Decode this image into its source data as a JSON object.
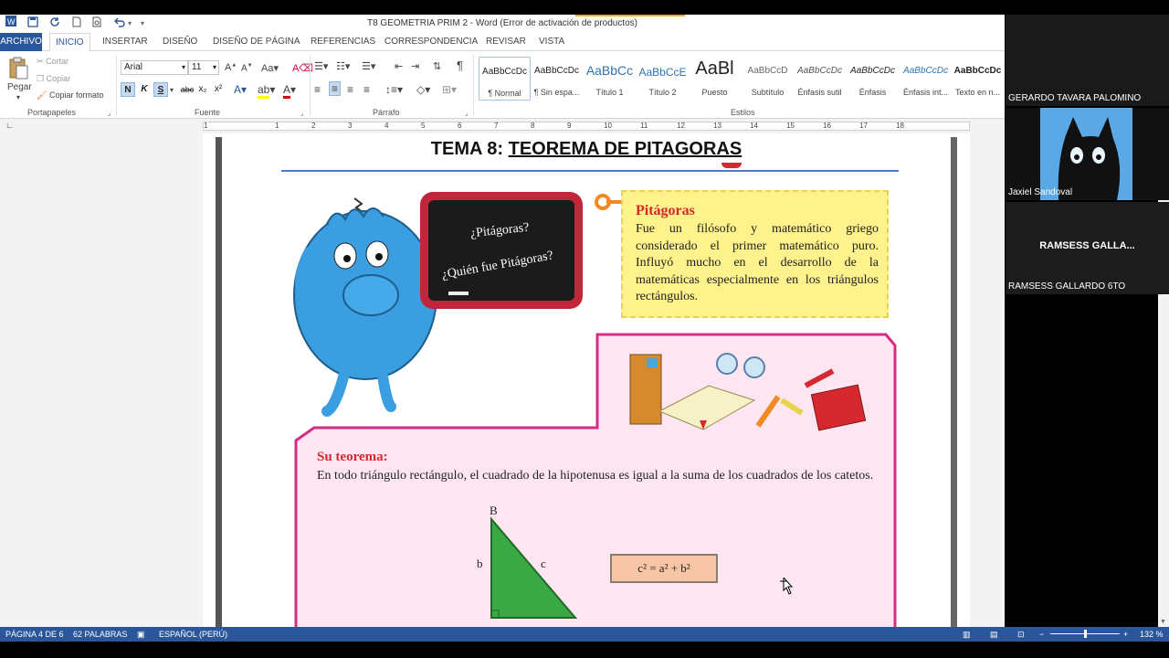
{
  "window": {
    "title": "T8 GEOMETRIA PRIM 2 - Word (Error de activación de productos)"
  },
  "tabs": [
    "ARCHIVO",
    "INICIO",
    "INSERTAR",
    "DISEÑO",
    "DISEÑO DE PÁGINA",
    "REFERENCIAS",
    "CORRESPONDENCIA",
    "REVISAR",
    "VISTA"
  ],
  "clipboard": {
    "paste": "Pegar",
    "cut": "Cortar",
    "copy": "Copiar",
    "format_painter": "Copiar formato",
    "group": "Portapapeles"
  },
  "font": {
    "name": "Arial",
    "size": "11",
    "bold": "N",
    "italic": "K",
    "underline": "S",
    "strike": "abc",
    "sub": "x₂",
    "sup": "x²",
    "group": "Fuente"
  },
  "paragraph": {
    "group": "Párrafo",
    "pilcrow": "¶"
  },
  "styles": {
    "group": "Estilos",
    "items": [
      {
        "preview": "AaBbCcDc",
        "name": "¶ Normal"
      },
      {
        "preview": "AaBbCcDc",
        "name": "¶ Sin espa..."
      },
      {
        "preview": "AaBbCc",
        "name": "Título 1"
      },
      {
        "preview": "AaBbCcE",
        "name": "Título 2"
      },
      {
        "preview": "AaBl",
        "name": "Puesto"
      },
      {
        "preview": "AaBbCcD",
        "name": "Subtítulo"
      },
      {
        "preview": "AaBbCcDc",
        "name": "Énfasis sutil"
      },
      {
        "preview": "AaBbCcDc",
        "name": "Énfasis"
      },
      {
        "preview": "AaBbCcDc",
        "name": "Énfasis int..."
      },
      {
        "preview": "AaBbCcDc",
        "name": "Texto en n..."
      }
    ]
  },
  "ruler": {
    "ticks": [
      "1",
      "1",
      "2",
      "3",
      "4",
      "5",
      "6",
      "7",
      "8",
      "9",
      "10",
      "11",
      "12",
      "13",
      "14",
      "15",
      "16",
      "17",
      "18"
    ]
  },
  "document": {
    "title_prefix": "TEMA 8:",
    "title_main": "TEOREMA DE PITAGORAS",
    "chalk_q1": "¿Pitágoras?",
    "chalk_q2": "¿Quién fue Pitágoras?",
    "info_heading": "Pitágoras",
    "info_text": "Fue un filósofo y matemático griego considerado el primer matemático puro. Influyó mucho en el desarrollo de la matemáticas especialmente en los triángulos rectángulos.",
    "theorem_heading": "Su teorema:",
    "theorem_text": "En todo triángulo rectángulo, el cuadrado de la hipotenusa es igual a la suma de los cuadrados de los catetos.",
    "formula": "c² = a² + b²",
    "vertex_b": "B",
    "side_b": "b",
    "side_c": "c"
  },
  "status": {
    "page": "PÁGINA 4 DE 6",
    "words": "62 PALABRAS",
    "language": "ESPAÑOL (PERÚ)",
    "zoom": "132 %"
  },
  "participants": [
    {
      "name": "GERARDO TAVARA PALOMINO"
    },
    {
      "name": "Jaxiel Sandoval"
    },
    {
      "name": "RAMSESS GALLARDO 6TO",
      "display": "RAMSESS  GALLA..."
    }
  ],
  "colors": {
    "word_blue": "#2b579a",
    "title_red": "#d6282f",
    "triangle_green": "#3aa845",
    "pink_border": "#d62b83"
  }
}
